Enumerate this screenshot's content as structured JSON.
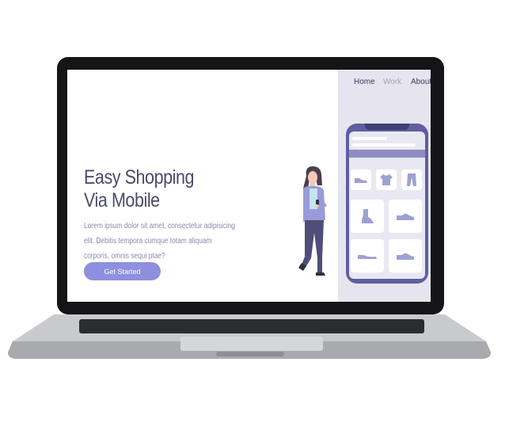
{
  "nav": {
    "home": "Home",
    "work": "Work",
    "about": "About"
  },
  "hero": {
    "title_line1": "Easy Shopping",
    "title_line2": "Via Mobile",
    "body_line1": "Lorem ipsum dolor sit amet, consectetur adipisicing",
    "body_line2": "elit. Debitis tempora cumque totam aliquam",
    "body_line3": "corporis, omnis sequi ptae?",
    "cta": "Get Started"
  },
  "colors": {
    "accent": "#8e8fdf",
    "title": "#4a4b6b",
    "panel": "#e6e4ee",
    "phone": "#5d5fa1"
  },
  "icons": [
    "sneaker-icon",
    "tshirt-icon",
    "pants-icon",
    "boot-icon",
    "shoe-icon",
    "sneaker-icon",
    "shoe-icon"
  ]
}
